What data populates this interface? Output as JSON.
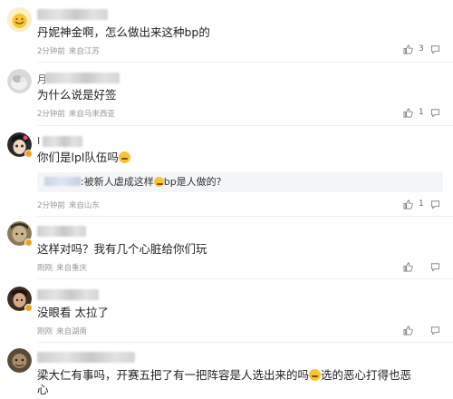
{
  "comments": [
    {
      "initial": "",
      "text": "丹妮神金啊，怎么做出来这种bp的",
      "time": "2分钟前",
      "location": "来自江苏",
      "like_count": "3"
    },
    {
      "initial": "月",
      "text": "为什么说是好签",
      "time": "2分钟前",
      "location": "来自马来西亚",
      "like_count": "1"
    },
    {
      "initial": "I",
      "text": "你们是lpl队伍吗",
      "quote_suffix": ":被新人虐成这样",
      "quote_tail": "bp是人做的?",
      "time": "2分钟前",
      "location": "来自山东",
      "like_count": "1"
    },
    {
      "initial": "",
      "text": "这样对吗？我有几个心脏给你们玩",
      "time": "刚刚",
      "location": "来自重庆",
      "like_count": ""
    },
    {
      "initial": "",
      "text": "没眼看 太拉了",
      "time": "刚刚",
      "location": "来自湖南",
      "like_count": ""
    },
    {
      "initial": "",
      "text_line1_a": "梁大仁有事吗，开赛五把了有一把阵容是人选出来的吗",
      "text_line1_b": "选的恶心打得也恶",
      "text_line2": "心"
    }
  ],
  "icons": {
    "like": "thumbs-up-icon",
    "reply": "comment-bubble-icon",
    "emoji": "smiling-face-emoji"
  }
}
